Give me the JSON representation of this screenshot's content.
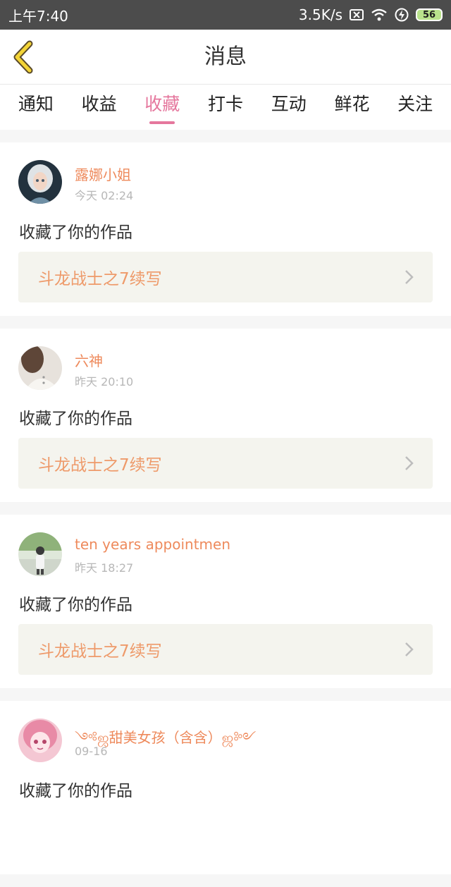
{
  "status_bar": {
    "time": "上午7:40",
    "speed": "3.5K/s",
    "battery": "56"
  },
  "header": {
    "title": "消息"
  },
  "tabs": [
    {
      "label": "通知",
      "active": false
    },
    {
      "label": "收益",
      "active": false
    },
    {
      "label": "收藏",
      "active": true
    },
    {
      "label": "打卡",
      "active": false
    },
    {
      "label": "互动",
      "active": false
    },
    {
      "label": "鲜花",
      "active": false
    },
    {
      "label": "关注",
      "active": false
    }
  ],
  "colors": {
    "accent": "#e5779d",
    "username": "#ee8a5c",
    "work_title": "#ee9a6a",
    "status_bar": "#4c4c4c"
  },
  "messages": [
    {
      "name": "露娜小姐",
      "time": "今天 02:24",
      "action": "收藏了你的作品",
      "work": "斗龙战士之7续写"
    },
    {
      "name": "六神",
      "time": "昨天 20:10",
      "action": "收藏了你的作品",
      "work": "斗龙战士之7续写"
    },
    {
      "name": "ten years appointmen",
      "time": "昨天 18:27",
      "action": "收藏了你的作品",
      "work": "斗龙战士之7续写"
    },
    {
      "name": "༺ஜ甜美女孩（含含）ஜ༻",
      "time": "09-16",
      "action": "收藏了你的作品",
      "work": ""
    }
  ]
}
